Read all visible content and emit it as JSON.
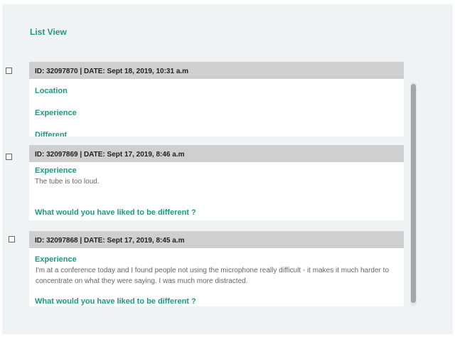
{
  "view_title": "List View",
  "records": [
    {
      "header": "ID: 32097870 | DATE: Sept 18, 2019, 10:31 a.m",
      "questions": [
        "Location",
        "Experience",
        "Different"
      ]
    },
    {
      "header": "ID: 32097869 | DATE: Sept 17, 2019, 8:46 a.m",
      "experience_label": "Experience",
      "experience_text": "The tube is too loud.",
      "different_label": "What would you have liked to be different ?"
    },
    {
      "header": "ID: 32097868 | DATE: Sept 17, 2019, 8:45 a.m",
      "experience_label": "Experience",
      "experience_text": "I'm at a conference today and I found people not using the microphone really difficult - it  makes it much harder to concentrate on what they were saying. I was much more distracted.",
      "different_label": "What would you have liked to be different ?"
    }
  ]
}
